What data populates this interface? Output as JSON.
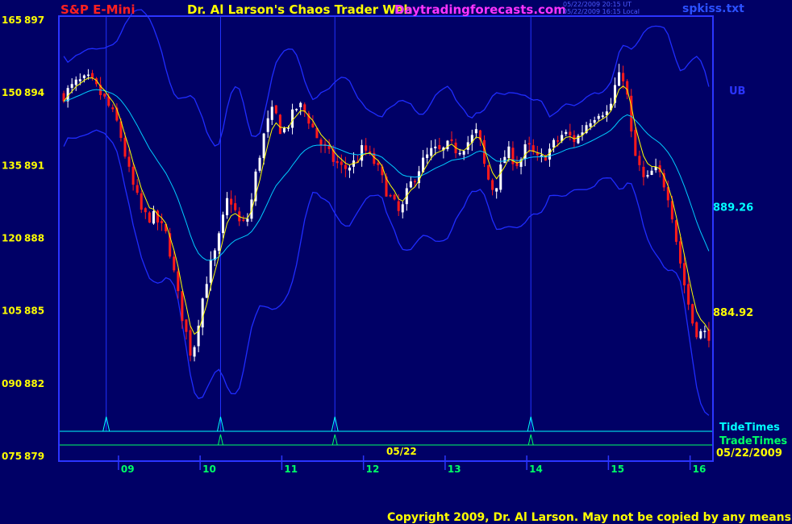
{
  "header": {
    "symbol": "S&P E-Mini",
    "title": "Dr. Al Larson's Chaos Trader Web",
    "site": "Daytradingforecasts.com",
    "stamp1": "05/22/2009 20:15 UT",
    "stamp2": "05/22/2009 16:15 Local",
    "file": "spkiss.txt"
  },
  "footer": {
    "copyright": "Copyright 2009, Dr. Al Larson. May not be copied by any means.",
    "date": "05/22/2009",
    "session_label": "05/22"
  },
  "colors": {
    "background": "#000066",
    "frame": "#2b35ff",
    "up_candle": "#ffffff",
    "down_candle": "#ff1a1a",
    "ema_short": "#ffff00",
    "ema_long": "#00ccff",
    "bands": "#1f2cff",
    "tide": "#00ffff",
    "trade": "#00ff66",
    "hour_labels": "#00ff66",
    "axis_text": "#ffff00"
  },
  "chart_data": {
    "type": "candlestick",
    "y_axis": {
      "range": [
        878.8,
        897.1
      ],
      "ticks": [
        {
          "left": "165",
          "right": "897",
          "value": 897
        },
        {
          "left": "150",
          "right": "894",
          "value": 894
        },
        {
          "left": "135",
          "right": "891",
          "value": 891
        },
        {
          "left": "120",
          "right": "888",
          "value": 888
        },
        {
          "left": "105",
          "right": "885",
          "value": 885
        },
        {
          "left": "090",
          "right": "882",
          "value": 882
        },
        {
          "left": "075",
          "right": "879",
          "value": 879
        }
      ]
    },
    "x_axis": {
      "range": [
        8.28,
        16.28
      ],
      "ticks": [
        {
          "label": "09",
          "value": 9
        },
        {
          "label": "10",
          "value": 10
        },
        {
          "label": "11",
          "value": 11
        },
        {
          "label": "12",
          "value": 12
        },
        {
          "label": "13",
          "value": 13
        },
        {
          "label": "14",
          "value": 14
        },
        {
          "label": "15",
          "value": 15
        },
        {
          "label": "16",
          "value": 16
        }
      ]
    },
    "tide_times": [
      8.85,
      10.25,
      11.65,
      14.05
    ],
    "trade_times": [
      10.25,
      11.65,
      14.05
    ],
    "legend": {
      "tide": "TideTimes",
      "trade": "TradeTimes",
      "upper_band": "UB"
    },
    "price_labels": [
      {
        "label": "889.26",
        "value": 889.26,
        "series": "ema_long"
      },
      {
        "label": "884.92",
        "value": 884.92,
        "series": "ema_short"
      }
    ],
    "close_series_knots": [
      [
        8.3,
        893.8
      ],
      [
        8.5,
        894.4
      ],
      [
        8.65,
        894.5
      ],
      [
        8.85,
        893.6
      ],
      [
        9.0,
        892.6
      ],
      [
        9.15,
        890.4
      ],
      [
        9.3,
        888.9
      ],
      [
        9.45,
        888.8
      ],
      [
        9.6,
        888.0
      ],
      [
        9.75,
        885.2
      ],
      [
        9.9,
        883.0
      ],
      [
        10.0,
        885.0
      ],
      [
        10.1,
        886.6
      ],
      [
        10.2,
        887.5
      ],
      [
        10.35,
        889.8
      ],
      [
        10.5,
        888.4
      ],
      [
        10.6,
        888.9
      ],
      [
        10.7,
        891.0
      ],
      [
        10.8,
        892.5
      ],
      [
        10.9,
        893.3
      ],
      [
        11.0,
        892.3
      ],
      [
        11.1,
        892.8
      ],
      [
        11.2,
        893.5
      ],
      [
        11.3,
        893.1
      ],
      [
        11.45,
        892.0
      ],
      [
        11.6,
        891.3
      ],
      [
        11.75,
        890.8
      ],
      [
        11.9,
        891.1
      ],
      [
        12.0,
        891.7
      ],
      [
        12.15,
        891.0
      ],
      [
        12.3,
        889.8
      ],
      [
        12.45,
        888.9
      ],
      [
        12.55,
        890.0
      ],
      [
        12.7,
        891.0
      ],
      [
        12.85,
        891.6
      ],
      [
        12.95,
        891.5
      ],
      [
        13.05,
        891.8
      ],
      [
        13.15,
        891.6
      ],
      [
        13.3,
        892.0
      ],
      [
        13.4,
        892.4
      ],
      [
        13.5,
        890.6
      ],
      [
        13.6,
        889.9
      ],
      [
        13.75,
        891.6
      ],
      [
        13.9,
        891.0
      ],
      [
        14.0,
        891.8
      ],
      [
        14.15,
        891.1
      ],
      [
        14.3,
        891.7
      ],
      [
        14.45,
        892.3
      ],
      [
        14.6,
        892.0
      ],
      [
        14.75,
        892.8
      ],
      [
        14.9,
        893.3
      ],
      [
        15.0,
        893.1
      ],
      [
        15.1,
        894.5
      ],
      [
        15.2,
        894.7
      ],
      [
        15.3,
        891.6
      ],
      [
        15.45,
        890.2
      ],
      [
        15.55,
        890.8
      ],
      [
        15.65,
        890.5
      ],
      [
        15.75,
        889.6
      ],
      [
        15.85,
        887.5
      ],
      [
        15.95,
        885.7
      ],
      [
        16.05,
        884.2
      ],
      [
        16.15,
        884.0
      ]
    ]
  }
}
